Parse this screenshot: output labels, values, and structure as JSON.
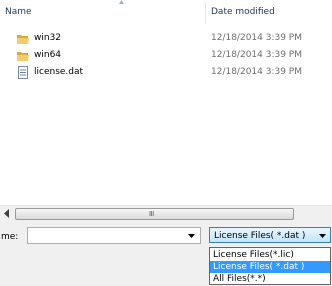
{
  "header": {
    "name_label": "Name",
    "date_label": "Date modified"
  },
  "files": [
    {
      "name": "win32",
      "date": "12/18/2014 3:39 PM",
      "icon": "folder-icon"
    },
    {
      "name": "win64",
      "date": "12/18/2014 3:39 PM",
      "icon": "folder-icon"
    },
    {
      "name": "license.dat",
      "date": "12/18/2014 3:39 PM",
      "icon": "file-icon"
    }
  ],
  "scrollbar": {
    "left_arrow": "left-arrow-icon",
    "grip": "III"
  },
  "filename": {
    "label": "me:",
    "value": ""
  },
  "filetype": {
    "selected": "License Files( *.dat )",
    "options": [
      "License Files(*.lic)",
      "License Files( *.dat )",
      "All Files(*.*)"
    ],
    "highlighted_index": 1
  },
  "colors": {
    "folder": "#e8b84a",
    "selection": "#3399ff",
    "header_text": "#1e395b",
    "date_text": "#6d6d6d"
  }
}
